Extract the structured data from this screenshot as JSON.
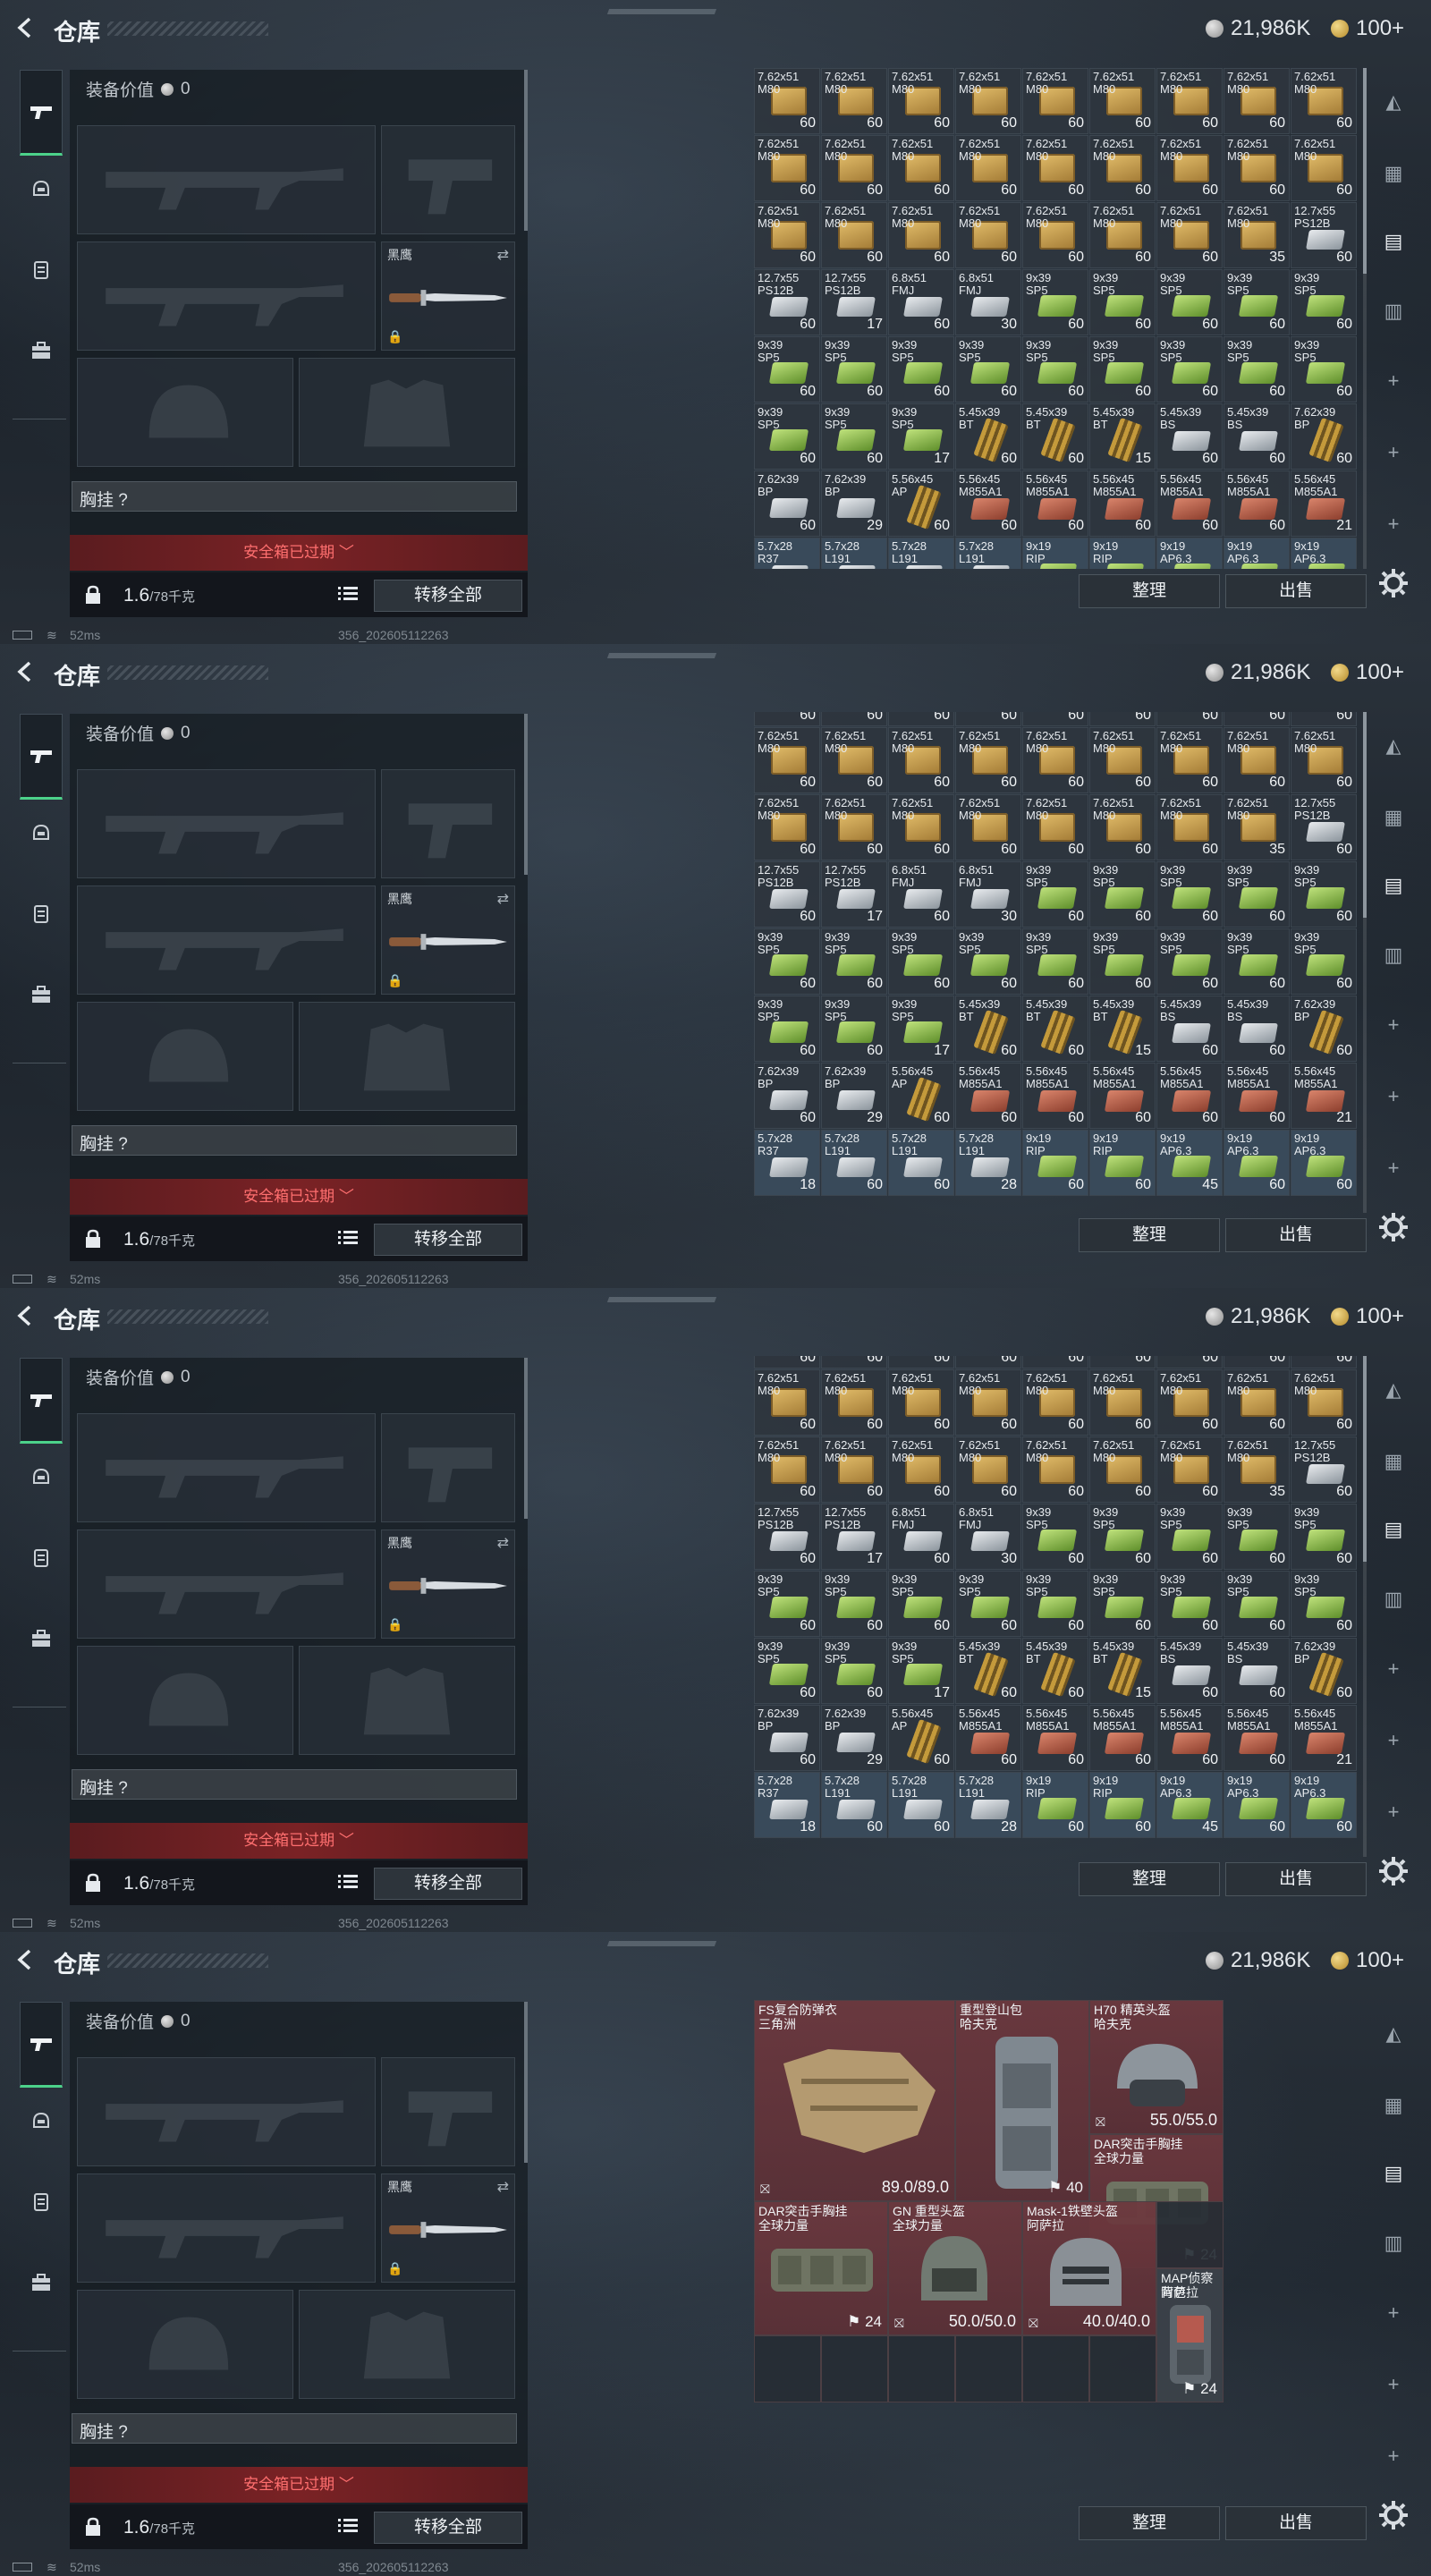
{
  "header": {
    "title": "仓库",
    "silver_amount": "21,986K",
    "gold_amount": "100+"
  },
  "loadout": {
    "equip_value_label": "装备价值",
    "equip_value": "0",
    "melee_name": "黑鹰",
    "chest_rig_label": "胸挂 ?",
    "safe_box_status": "安全箱已过期",
    "weight_current": "1.6",
    "weight_max": "/78千克",
    "transfer_all": "转移全部"
  },
  "actions": {
    "sort": "整理",
    "sell": "出售"
  },
  "status": {
    "ping": "52ms",
    "build": "356_202605112263"
  },
  "ammo_rows": [
    [
      [
        "7.62x51",
        "M80",
        "60",
        "tan"
      ],
      [
        "7.62x51",
        "M80",
        "60",
        "tan"
      ],
      [
        "7.62x51",
        "M80",
        "60",
        "tan"
      ],
      [
        "7.62x51",
        "M80",
        "60",
        "tan"
      ],
      [
        "7.62x51",
        "M80",
        "60",
        "tan"
      ],
      [
        "7.62x51",
        "M80",
        "60",
        "tan"
      ],
      [
        "7.62x51",
        "M80",
        "60",
        "tan"
      ],
      [
        "7.62x51",
        "M80",
        "60",
        "tan"
      ],
      [
        "7.62x51",
        "M80",
        "60",
        "tan"
      ]
    ],
    [
      [
        "7.62x51",
        "M80",
        "60",
        "tan"
      ],
      [
        "7.62x51",
        "M80",
        "60",
        "tan"
      ],
      [
        "7.62x51",
        "M80",
        "60",
        "tan"
      ],
      [
        "7.62x51",
        "M80",
        "60",
        "tan"
      ],
      [
        "7.62x51",
        "M80",
        "60",
        "tan"
      ],
      [
        "7.62x51",
        "M80",
        "60",
        "tan"
      ],
      [
        "7.62x51",
        "M80",
        "60",
        "tan"
      ],
      [
        "7.62x51",
        "M80",
        "60",
        "tan"
      ],
      [
        "7.62x51",
        "M80",
        "60",
        "tan"
      ]
    ],
    [
      [
        "7.62x51",
        "M80",
        "60",
        "tan"
      ],
      [
        "7.62x51",
        "M80",
        "60",
        "tan"
      ],
      [
        "7.62x51",
        "M80",
        "60",
        "tan"
      ],
      [
        "7.62x51",
        "M80",
        "60",
        "tan"
      ],
      [
        "7.62x51",
        "M80",
        "60",
        "tan"
      ],
      [
        "7.62x51",
        "M80",
        "60",
        "tan"
      ],
      [
        "7.62x51",
        "M80",
        "60",
        "tan"
      ],
      [
        "7.62x51",
        "M80",
        "35",
        "tan"
      ],
      [
        "12.7x55",
        "PS12B",
        "60",
        "silver"
      ]
    ],
    [
      [
        "12.7x55",
        "PS12B",
        "60",
        "silver"
      ],
      [
        "12.7x55",
        "PS12B",
        "17",
        "silver"
      ],
      [
        "6.8x51",
        "FMJ",
        "60",
        "silver"
      ],
      [
        "6.8x51",
        "FMJ",
        "30",
        "silver"
      ],
      [
        "9x39",
        "SP5",
        "60",
        "green"
      ],
      [
        "9x39",
        "SP5",
        "60",
        "green"
      ],
      [
        "9x39",
        "SP5",
        "60",
        "green"
      ],
      [
        "9x39",
        "SP5",
        "60",
        "green"
      ],
      [
        "9x39",
        "SP5",
        "60",
        "green"
      ]
    ],
    [
      [
        "9x39",
        "SP5",
        "60",
        "green"
      ],
      [
        "9x39",
        "SP5",
        "60",
        "green"
      ],
      [
        "9x39",
        "SP5",
        "60",
        "green"
      ],
      [
        "9x39",
        "SP5",
        "60",
        "green"
      ],
      [
        "9x39",
        "SP5",
        "60",
        "green"
      ],
      [
        "9x39",
        "SP5",
        "60",
        "green"
      ],
      [
        "9x39",
        "SP5",
        "60",
        "green"
      ],
      [
        "9x39",
        "SP5",
        "60",
        "green"
      ],
      [
        "9x39",
        "SP5",
        "60",
        "green"
      ]
    ],
    [
      [
        "9x39",
        "SP5",
        "60",
        "green"
      ],
      [
        "9x39",
        "SP5",
        "60",
        "green"
      ],
      [
        "9x39",
        "SP5",
        "17",
        "green"
      ],
      [
        "5.45x39",
        "BT",
        "60",
        "rounds"
      ],
      [
        "5.45x39",
        "BT",
        "60",
        "rounds"
      ],
      [
        "5.45x39",
        "BT",
        "15",
        "rounds"
      ],
      [
        "5.45x39",
        "BS",
        "60",
        "silver"
      ],
      [
        "5.45x39",
        "BS",
        "60",
        "silver"
      ],
      [
        "7.62x39",
        "BP",
        "60",
        "rounds"
      ]
    ],
    [
      [
        "7.62x39",
        "BP",
        "60",
        "silver"
      ],
      [
        "7.62x39",
        "BP",
        "29",
        "silver"
      ],
      [
        "5.56x45",
        "AP",
        "60",
        "rounds"
      ],
      [
        "5.56x45",
        "M855A1",
        "60",
        "red"
      ],
      [
        "5.56x45",
        "M855A1",
        "60",
        "red"
      ],
      [
        "5.56x45",
        "M855A1",
        "60",
        "red"
      ],
      [
        "5.56x45",
        "M855A1",
        "60",
        "red"
      ],
      [
        "5.56x45",
        "M855A1",
        "60",
        "red"
      ],
      [
        "5.56x45",
        "M855A1",
        "21",
        "red"
      ]
    ],
    [
      [
        "5.7x28",
        "R37",
        "18",
        "silver"
      ],
      [
        "5.7x28",
        "L191",
        "60",
        "silver"
      ],
      [
        "5.7x28",
        "L191",
        "60",
        "silver"
      ],
      [
        "5.7x28",
        "L191",
        "28",
        "silver"
      ],
      [
        "9x19",
        "RIP",
        "60",
        "green"
      ],
      [
        "9x19",
        "RIP",
        "60",
        "green"
      ],
      [
        "9x19",
        "AP6.3",
        "45",
        "green"
      ],
      [
        "9x19",
        "AP6.3",
        "60",
        "green"
      ],
      [
        "9x19",
        "AP6.3",
        "60",
        "green"
      ]
    ]
  ],
  "gear": {
    "armor1_name": "FS复合防弹衣",
    "armor1_sub": "三角洲",
    "armor1_dur": "89.0/89.0",
    "pack1_name": "重型登山包",
    "pack1_sub": "哈夫克",
    "pack1_cap": "40",
    "helm1_name": "H70 精英头盔",
    "helm1_sub": "哈夫克",
    "helm1_dur": "55.0/55.0",
    "rig1_name": "DAR突击手胸挂",
    "rig1_sub": "全球力量",
    "rig1_cap": "24",
    "rig2_name": "DAR突击手胸挂",
    "rig2_sub": "全球力量",
    "rig2_cap": "24",
    "helm2_name": "GN 重型头盔",
    "helm2_sub": "全球力量",
    "helm2_dur": "50.0/50.0",
    "helm3_name": "Mask-1铁壁头盔",
    "helm3_sub": "阿萨拉",
    "helm3_dur": "40.0/40.0",
    "pack2_name": "MAP侦察背包",
    "pack2_sub": "阿萨拉",
    "pack2_cap": "24"
  },
  "colors": {
    "accent_green": "#4cd28a",
    "safe_red": "#ff6f6f"
  }
}
